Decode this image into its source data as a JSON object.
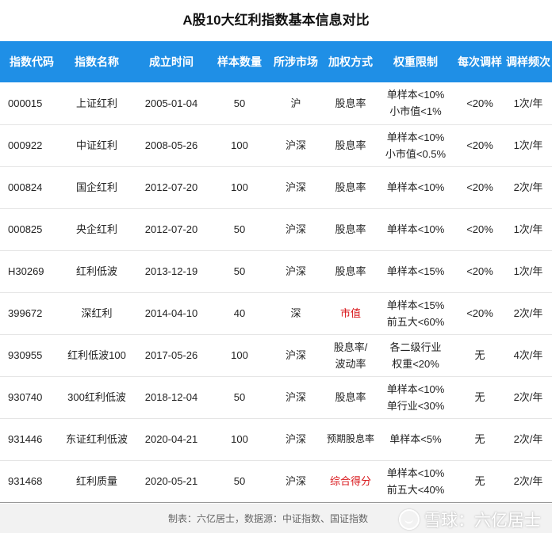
{
  "title": "A股10大红利指数基本信息对比",
  "headers": [
    "指数代码",
    "指数名称",
    "成立时间",
    "样本数量",
    "所涉市场",
    "加权方式",
    "权重限制",
    "每次调样",
    "调样频次"
  ],
  "rows": [
    {
      "code": "000015",
      "name": "上证红利",
      "date": "2005-01-04",
      "count": "50",
      "market": "沪",
      "weight": [
        "股息率"
      ],
      "weight_red": false,
      "limit": [
        "单样本<10%",
        "小市值<1%"
      ],
      "adjust": "<20%",
      "freq": "1次/年"
    },
    {
      "code": "000922",
      "name": "中证红利",
      "date": "2008-05-26",
      "count": "100",
      "market": "沪深",
      "weight": [
        "股息率"
      ],
      "weight_red": false,
      "limit": [
        "单样本<10%",
        "小市值<0.5%"
      ],
      "adjust": "<20%",
      "freq": "1次/年"
    },
    {
      "code": "000824",
      "name": "国企红利",
      "date": "2012-07-20",
      "count": "100",
      "market": "沪深",
      "weight": [
        "股息率"
      ],
      "weight_red": false,
      "limit": [
        "单样本<10%"
      ],
      "adjust": "<20%",
      "freq": "2次/年"
    },
    {
      "code": "000825",
      "name": "央企红利",
      "date": "2012-07-20",
      "count": "50",
      "market": "沪深",
      "weight": [
        "股息率"
      ],
      "weight_red": false,
      "limit": [
        "单样本<10%"
      ],
      "adjust": "<20%",
      "freq": "1次/年"
    },
    {
      "code": "H30269",
      "name": "红利低波",
      "date": "2013-12-19",
      "count": "50",
      "market": "沪深",
      "weight": [
        "股息率"
      ],
      "weight_red": false,
      "limit": [
        "单样本<15%"
      ],
      "adjust": "<20%",
      "freq": "1次/年"
    },
    {
      "code": "399672",
      "name": "深红利",
      "date": "2014-04-10",
      "count": "40",
      "market": "深",
      "weight": [
        "市值"
      ],
      "weight_red": true,
      "limit": [
        "单样本<15%",
        "前五大<60%"
      ],
      "adjust": "<20%",
      "freq": "2次/年"
    },
    {
      "code": "930955",
      "name": "红利低波100",
      "date": "2017-05-26",
      "count": "100",
      "market": "沪深",
      "weight": [
        "股息率/",
        "波动率"
      ],
      "weight_red": false,
      "limit": [
        "各二级行业",
        "权重<20%"
      ],
      "adjust": "无",
      "freq": "4次/年"
    },
    {
      "code": "930740",
      "name": "300红利低波",
      "date": "2018-12-04",
      "count": "50",
      "market": "沪深",
      "weight": [
        "股息率"
      ],
      "weight_red": false,
      "limit": [
        "单样本<10%",
        "单行业<30%"
      ],
      "adjust": "无",
      "freq": "2次/年"
    },
    {
      "code": "931446",
      "name": "东证红利低波",
      "date": "2020-04-21",
      "count": "100",
      "market": "沪深",
      "weight": [
        "预期股息率"
      ],
      "weight_red": false,
      "weight_small": true,
      "limit": [
        "单样本<5%"
      ],
      "adjust": "无",
      "freq": "2次/年"
    },
    {
      "code": "931468",
      "name": "红利质量",
      "date": "2020-05-21",
      "count": "50",
      "market": "沪深",
      "weight": [
        "综合得分"
      ],
      "weight_red": true,
      "limit": [
        "单样本<10%",
        "前五大<40%"
      ],
      "adjust": "无",
      "freq": "2次/年"
    }
  ],
  "footer": {
    "source": "制表：六亿居士，数据源：中证指数、国证指数",
    "watermark": "雪球：六亿居士"
  },
  "colors": {
    "header_bg": "#1f8fe6",
    "accent_red": "#d9181c"
  }
}
